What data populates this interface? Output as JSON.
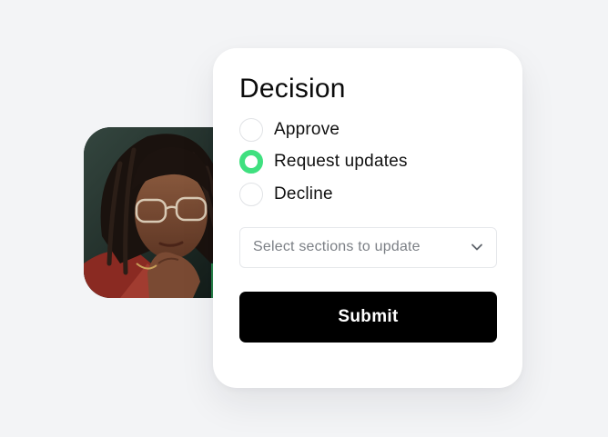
{
  "decision": {
    "title": "Decision",
    "options": [
      {
        "label": "Approve",
        "checked": false
      },
      {
        "label": "Request updates",
        "checked": true
      },
      {
        "label": "Decline",
        "checked": false
      }
    ],
    "sections_select": {
      "placeholder": "Select sections to update"
    },
    "submit_label": "Submit"
  },
  "colors": {
    "accent_green": "#3fe07f",
    "button_black": "#000000",
    "card_bg": "#ffffff",
    "page_bg": "#f3f4f6"
  },
  "icons": {
    "select_chevron": "chevron-down-icon",
    "radio": "radio-button-icon"
  }
}
